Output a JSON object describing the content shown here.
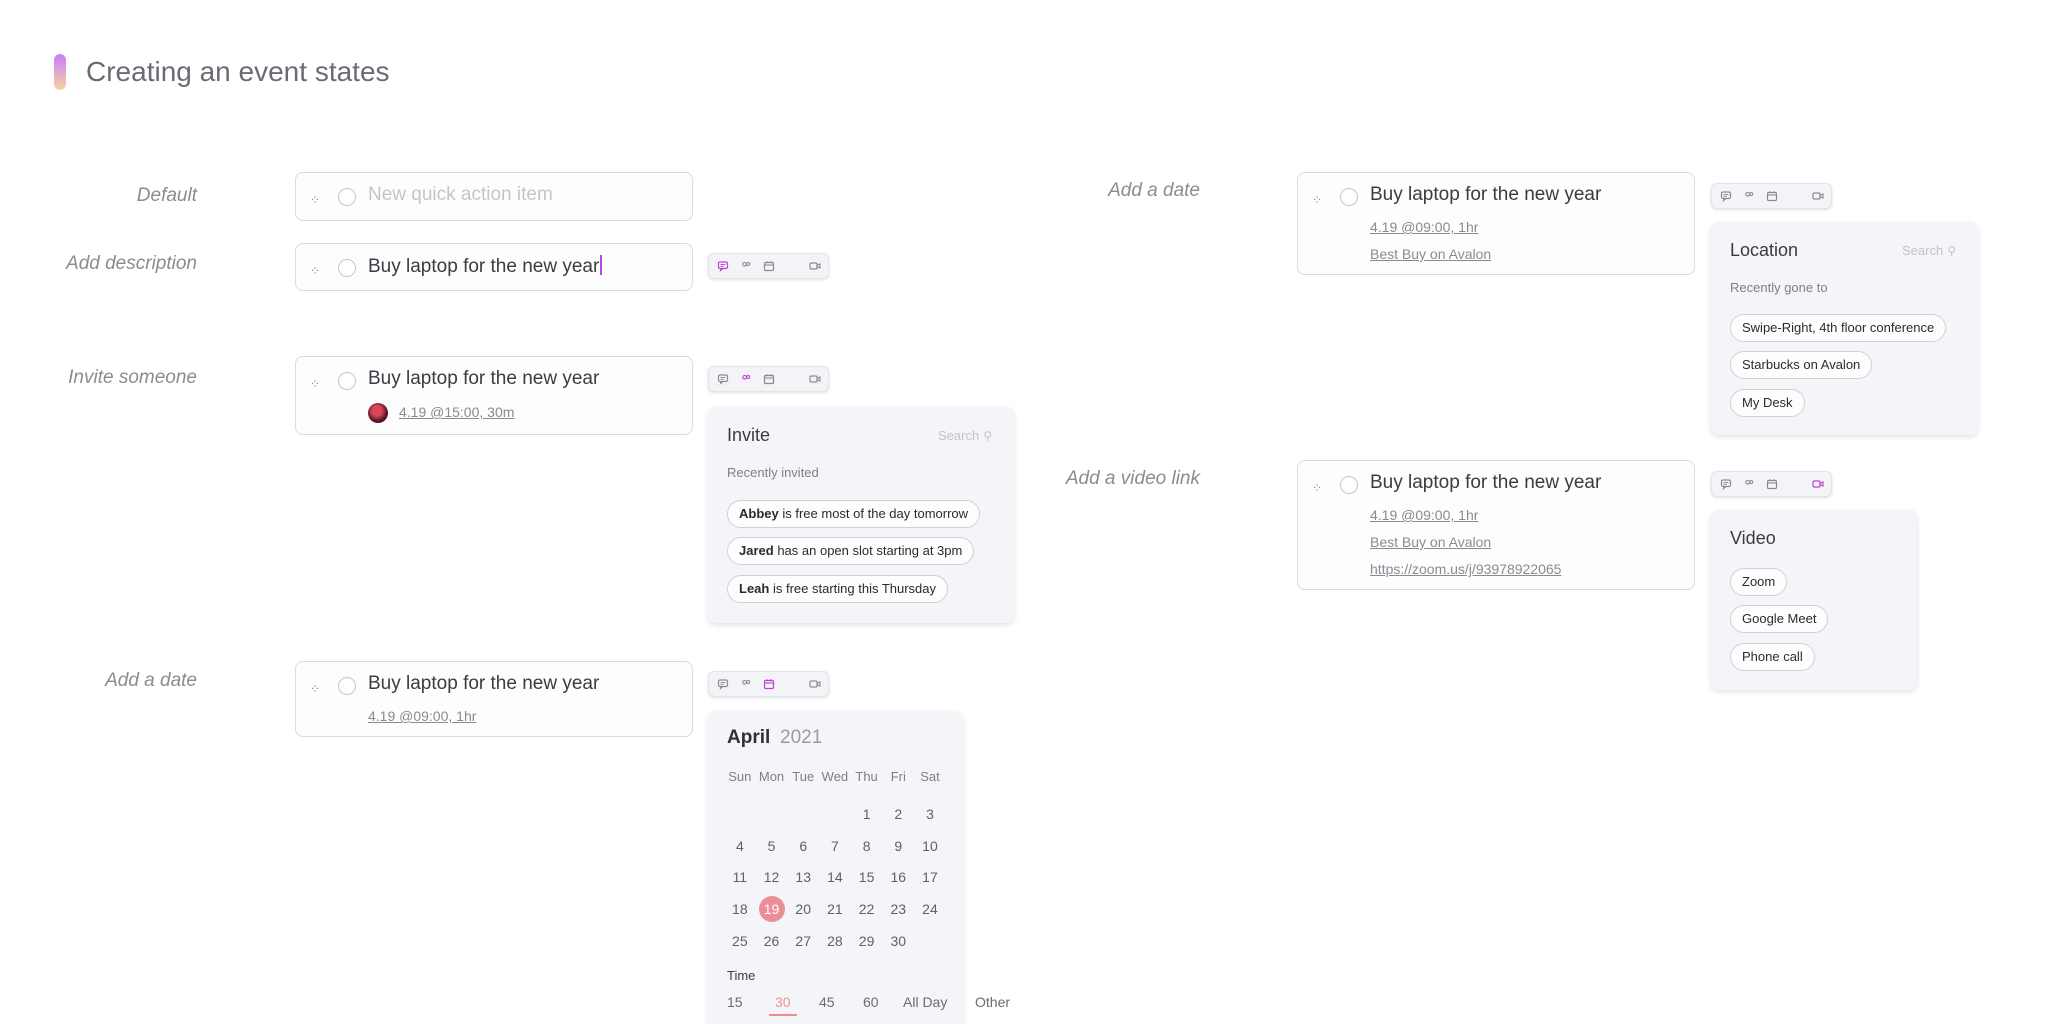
{
  "page": {
    "title": "Creating an event states"
  },
  "colors": {
    "accent": "#c77dff",
    "selected_day": "#ea8f98",
    "active_icon": "#c13fd6",
    "icon": "#8a8a92"
  },
  "labels": {
    "default": "Default",
    "add_description": "Add description",
    "invite_someone": "Invite someone",
    "add_date_left": "Add a date",
    "add_date_right": "Add a date",
    "add_video_link": "Add a video link"
  },
  "cards": {
    "default": {
      "placeholder": "New quick action item"
    },
    "description": {
      "title": "Buy laptop for the new year"
    },
    "invite": {
      "title": "Buy laptop for the new year",
      "meta": "4.19 @15:00, 30m"
    },
    "date": {
      "title": "Buy laptop for the new year",
      "meta": "4.19 @09:00, 1hr"
    },
    "location": {
      "title": "Buy laptop for the new year",
      "meta": "4.19 @09:00, 1hr",
      "location": "Best Buy on Avalon"
    },
    "video": {
      "title": "Buy laptop for the new year",
      "meta": "4.19 @09:00, 1hr",
      "location": "Best Buy on Avalon",
      "link": "https://zoom.us/j/93978922065"
    }
  },
  "toolbar_icons": [
    "comment-icon",
    "invite-icon",
    "calendar-icon",
    "location-pin-icon",
    "video-icon"
  ],
  "invite_panel": {
    "title": "Invite",
    "search": "Search",
    "subtitle": "Recently invited",
    "items": [
      {
        "name": "Abbey",
        "text": "is free most of the day tomorrow"
      },
      {
        "name": "Jared",
        "text": "has an open slot starting at 3pm"
      },
      {
        "name": "Leah",
        "text": "is free starting this Thursday"
      }
    ]
  },
  "location_panel": {
    "title": "Location",
    "search": "Search",
    "subtitle": "Recently gone to",
    "items": [
      "Swipe-Right, 4th floor conference",
      "Starbucks on Avalon",
      "My Desk"
    ]
  },
  "video_panel": {
    "title": "Video",
    "items": [
      "Zoom",
      "Google Meet",
      "Phone call"
    ]
  },
  "calendar": {
    "month": "April",
    "year": "2021",
    "weekdays": [
      "Sun",
      "Mon",
      "Tue",
      "Wed",
      "Thu",
      "Fri",
      "Sat"
    ],
    "first_weekday_index": 4,
    "days_in_month": 30,
    "selected_day": 19,
    "time_label": "Time",
    "time_options": [
      "15",
      "30",
      "45",
      "60",
      "All Day",
      "Other"
    ],
    "selected_time": "30"
  }
}
